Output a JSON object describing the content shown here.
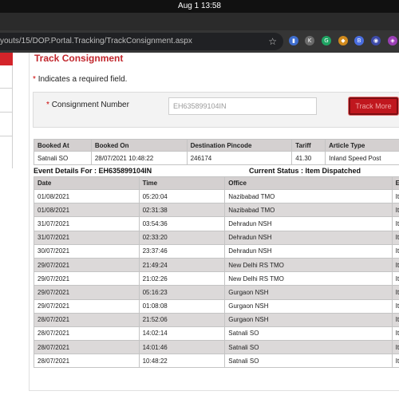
{
  "os": {
    "clock": "Aug 1  13:58"
  },
  "browser": {
    "url": "youts/15/DOP.Portal.Tracking/TrackConsignment.aspx",
    "star_icon": "star-icon"
  },
  "page": {
    "title": "Track Consignment",
    "required_note": "Indicates a required field.",
    "required_marker": "*",
    "form": {
      "label": "Consignment Number",
      "input_value": "EH635899104IN",
      "button_label": "Track More"
    },
    "booking": {
      "headers": [
        "Booked At",
        "Booked On",
        "Destination Pincode",
        "Tariff",
        "Article Type"
      ],
      "row": [
        "Satnali SO",
        "28/07/2021 10:48:22",
        "246174",
        "41.30",
        "Inland Speed Post"
      ]
    },
    "event_details_label": "Event Details For : EH635899104IN",
    "current_status_label": "Current Status : Item Dispatched",
    "events": {
      "headers": [
        "Date",
        "Time",
        "Office",
        "E"
      ],
      "rows": [
        [
          "01/08/2021",
          "05:20:04",
          "Nazibabad TMO",
          "It"
        ],
        [
          "01/08/2021",
          "02:31:38",
          "Nazibabad TMO",
          "It"
        ],
        [
          "31/07/2021",
          "03:54:36",
          "Dehradun NSH",
          "It"
        ],
        [
          "31/07/2021",
          "02:33:20",
          "Dehradun NSH",
          "It"
        ],
        [
          "30/07/2021",
          "23:37:46",
          "Dehradun NSH",
          "It"
        ],
        [
          "29/07/2021",
          "21:49:24",
          "New Delhi RS TMO",
          "It"
        ],
        [
          "29/07/2021",
          "21:02:26",
          "New Delhi RS TMO",
          "It"
        ],
        [
          "29/07/2021",
          "05:16:23",
          "Gurgaon NSH",
          "It"
        ],
        [
          "29/07/2021",
          "01:08:08",
          "Gurgaon NSH",
          "It"
        ],
        [
          "28/07/2021",
          "21:52:06",
          "Gurgaon NSH",
          "It"
        ],
        [
          "28/07/2021",
          "14:02:14",
          "Satnali SO",
          "It"
        ],
        [
          "28/07/2021",
          "14:01:46",
          "Satnali SO",
          "It"
        ],
        [
          "28/07/2021",
          "10:48:22",
          "Satnali SO",
          "It"
        ]
      ]
    }
  },
  "colors": {
    "accent": "#c1272d",
    "button": "#c0171e",
    "header_bg": "#d4d0d0",
    "stripe": "#dcd9d9"
  }
}
